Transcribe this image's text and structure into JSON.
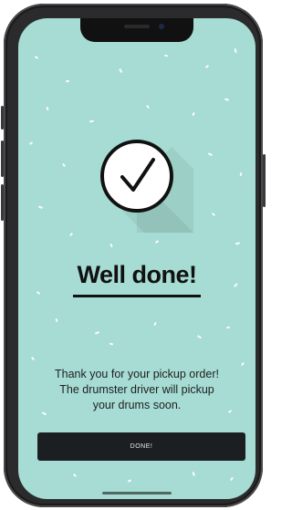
{
  "title": "Well done!",
  "message": "Thank you for your pickup order! The drumster driver will pickup your drums soon.",
  "done_button_label": "DONE!",
  "colors": {
    "background": "#a6dcd3",
    "accent": "#111111",
    "button": "#1c1f21",
    "confetti": "#ffffff"
  },
  "icons": {
    "success": "checkmark-circle-icon"
  }
}
